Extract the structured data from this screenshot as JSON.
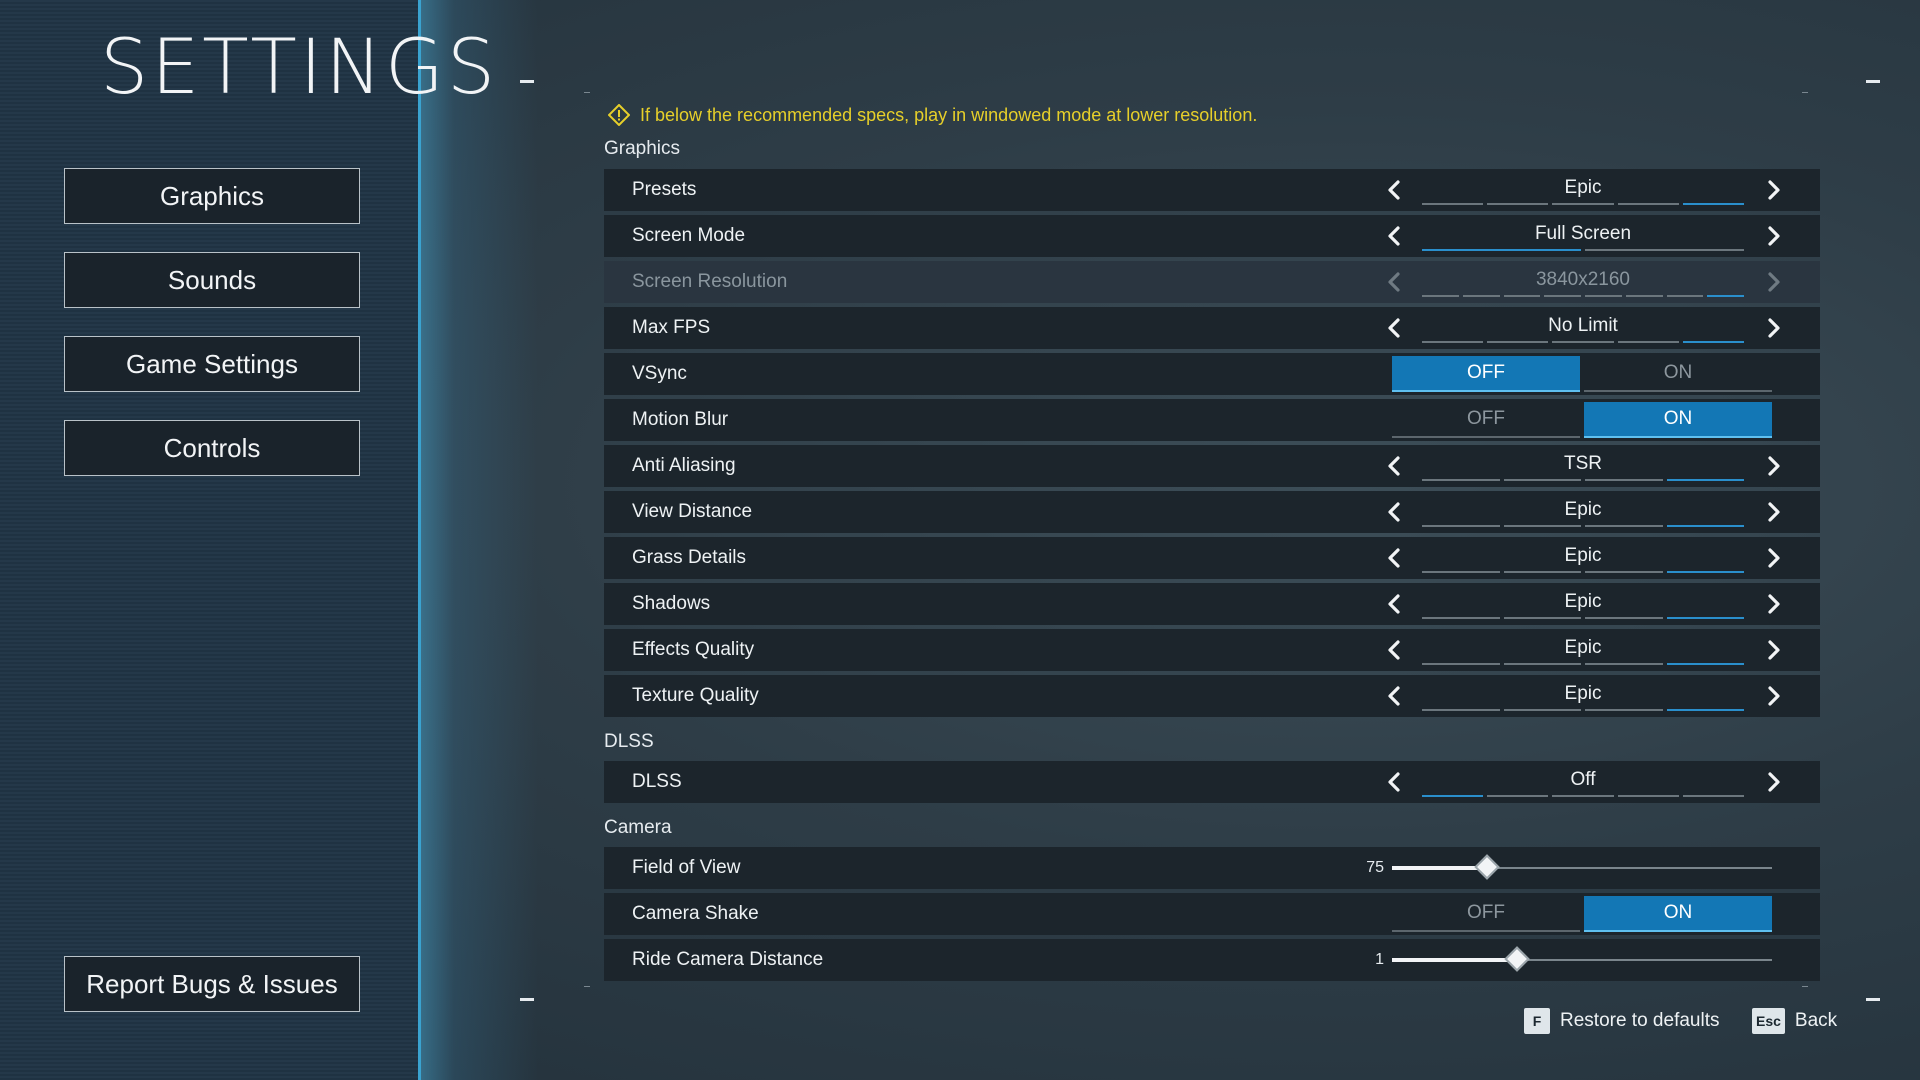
{
  "page_title": "SETTINGS",
  "nav": {
    "graphics": "Graphics",
    "sounds": "Sounds",
    "game_settings": "Game Settings",
    "controls": "Controls",
    "report_bugs": "Report Bugs & Issues"
  },
  "warning_text": "If below the recommended specs, play in windowed mode at lower resolution.",
  "sections": {
    "graphics": "Graphics",
    "dlss": "DLSS",
    "camera": "Camera"
  },
  "rows": {
    "presets": {
      "label": "Presets",
      "value": "Epic",
      "active_segment": 4,
      "segments": 5
    },
    "screen_mode": {
      "label": "Screen Mode",
      "value": "Full Screen",
      "active_segment": 0,
      "segments": 2
    },
    "screen_resolution": {
      "label": "Screen Resolution",
      "value": "3840x2160",
      "active_segment": 7,
      "segments": 8
    },
    "max_fps": {
      "label": "Max FPS",
      "value": "No Limit",
      "active_segment": 4,
      "segments": 5
    },
    "vsync": {
      "label": "VSync",
      "off": "OFF",
      "on": "ON",
      "state": "OFF"
    },
    "motion_blur": {
      "label": "Motion Blur",
      "off": "OFF",
      "on": "ON",
      "state": "ON"
    },
    "anti_aliasing": {
      "label": "Anti Aliasing",
      "value": "TSR",
      "active_segment": 3,
      "segments": 4
    },
    "view_distance": {
      "label": "View Distance",
      "value": "Epic",
      "active_segment": 3,
      "segments": 4
    },
    "grass_details": {
      "label": "Grass Details",
      "value": "Epic",
      "active_segment": 3,
      "segments": 4
    },
    "shadows": {
      "label": "Shadows",
      "value": "Epic",
      "active_segment": 3,
      "segments": 4
    },
    "effects_quality": {
      "label": "Effects Quality",
      "value": "Epic",
      "active_segment": 3,
      "segments": 4
    },
    "texture_quality": {
      "label": "Texture Quality",
      "value": "Epic",
      "active_segment": 3,
      "segments": 4
    },
    "dlss": {
      "label": "DLSS",
      "value": "Off",
      "active_segment": 0,
      "segments": 5
    },
    "field_of_view": {
      "label": "Field of View",
      "value": "75",
      "fraction": 0.25
    },
    "camera_shake": {
      "label": "Camera Shake",
      "off": "OFF",
      "on": "ON",
      "state": "ON"
    },
    "ride_camera_distance": {
      "label": "Ride Camera Distance",
      "value": "1",
      "fraction": 0.33
    }
  },
  "footer": {
    "restore_key": "F",
    "restore_label": "Restore to defaults",
    "back_key": "Esc",
    "back_label": "Back"
  },
  "colors": {
    "accent": "#1377b5",
    "warning": "#e6cf2a",
    "segment_active": "#2a8fcc"
  }
}
